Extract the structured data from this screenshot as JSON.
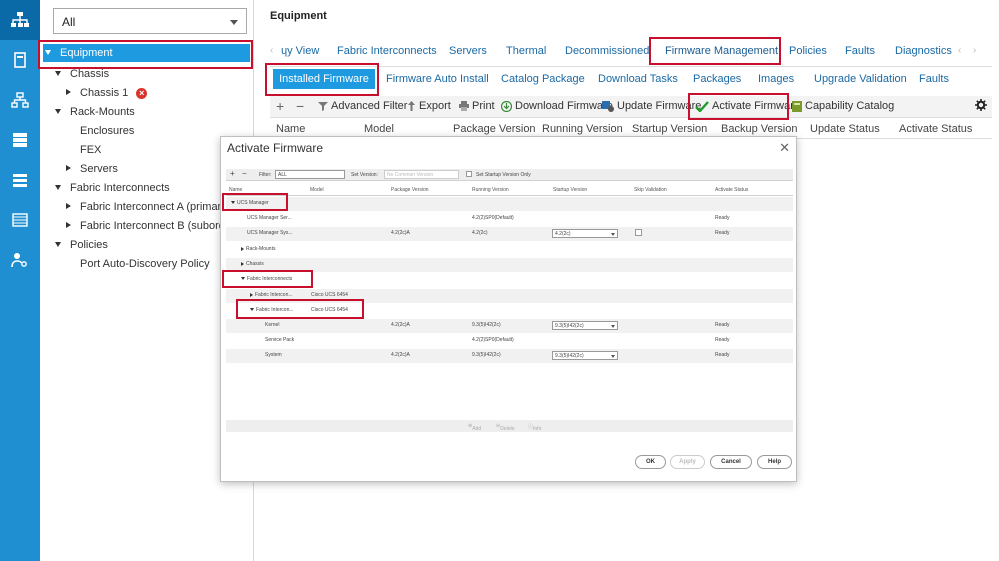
{
  "sidebar": {
    "filter_value": "All",
    "tree": {
      "equipment": "Equipment",
      "chassis": "Chassis",
      "chassis_1": "Chassis 1",
      "rack_mounts": "Rack-Mounts",
      "enclosures": "Enclosures",
      "fex": "FEX",
      "servers": "Servers",
      "fabric_interconnects": "Fabric Interconnects",
      "fi_a": "Fabric Interconnect A (primary)",
      "fi_b": "Fabric Interconnect B (subordinate)",
      "policies": "Policies",
      "port_auto_discovery": "Port Auto-Discovery Policy"
    }
  },
  "main": {
    "title": "Equipment",
    "tabs": [
      "ɥy View",
      "Fabric Interconnects",
      "Servers",
      "Thermal",
      "Decommissioned",
      "Firmware Management",
      "Policies",
      "Faults",
      "Diagnostics"
    ],
    "subtabs": [
      "Installed Firmware",
      "Firmware Auto Install",
      "Catalog Package",
      "Download Tasks",
      "Packages",
      "Images",
      "Upgrade Validation",
      "Faults"
    ],
    "toolbar": {
      "add": "+",
      "remove": "−",
      "advanced_filter": "Advanced Filter",
      "export": "Export",
      "print": "Print",
      "download_firmware": "Download Firmware",
      "update_firmware": "Update Firmware",
      "activate_firmware": "Activate Firmware",
      "capability_catalog": "Capability Catalog"
    },
    "columns": [
      "Name",
      "Model",
      "Package Version",
      "Running Version",
      "Startup Version",
      "Backup Version",
      "Update Status",
      "Activate Status"
    ]
  },
  "dialog": {
    "title": "Activate Firmware",
    "close": "✕",
    "toolbar": {
      "add": "+",
      "remove": "−",
      "filter_label": "Filter:",
      "filter_value": "ALL",
      "set_version_label": "Set Version:",
      "set_version_value": "No Common Version",
      "set_startup_only": "Set Startup Version Only"
    },
    "columns": [
      "Name",
      "Model",
      "Package Version",
      "Running Version",
      "Startup Version",
      "Skip Validation",
      "Activate Status"
    ],
    "rows": [
      {
        "name": "UCS Manager",
        "model": "",
        "pkg": "",
        "running": "",
        "startup": "",
        "status": ""
      },
      {
        "name": "UCS Manager Ser...",
        "model": "",
        "pkg": "",
        "running": "4.2(2)SP0(Default)",
        "startup": "",
        "status": "Ready"
      },
      {
        "name": "UCS Manager Sys...",
        "model": "",
        "pkg": "4.2(2c)A",
        "running": "4.2(2c)",
        "startup": "4.2(2c)",
        "status": "Ready"
      },
      {
        "name": "Rack-Mounts",
        "model": "",
        "pkg": "",
        "running": "",
        "startup": "",
        "status": ""
      },
      {
        "name": "Chassis",
        "model": "",
        "pkg": "",
        "running": "",
        "startup": "",
        "status": ""
      },
      {
        "name": "Fabric Interconnects",
        "model": "",
        "pkg": "",
        "running": "",
        "startup": "",
        "status": ""
      },
      {
        "name": "Fabric Intercon...",
        "model": "Cisco UCS 6454",
        "pkg": "",
        "running": "",
        "startup": "",
        "status": ""
      },
      {
        "name": "Fabric Intercon...",
        "model": "Cisco UCS 6454",
        "pkg": "",
        "running": "",
        "startup": "",
        "status": ""
      },
      {
        "name": "Kernel",
        "model": "",
        "pkg": "4.2(2c)A",
        "running": "9.3(5)I42(2c)",
        "startup": "9.3(5)I42(2c)",
        "status": "Ready"
      },
      {
        "name": "Service Pack",
        "model": "",
        "pkg": "",
        "running": "4.2(2)SP0(Default)",
        "startup": "",
        "status": "Ready"
      },
      {
        "name": "System",
        "model": "",
        "pkg": "4.2(2c)A",
        "running": "9.3(5)I42(2c)",
        "startup": "9.3(5)I42(2c)",
        "status": "Ready"
      }
    ],
    "footer": {
      "add": "Add",
      "delete": "Delete",
      "info": "Info"
    },
    "buttons": {
      "ok": "OK",
      "apply": "Apply",
      "cancel": "Cancel",
      "help": "Help"
    }
  },
  "colors": {
    "brand_blue": "#1e9ae0",
    "rail_blue": "#1f8fd1",
    "highlight_red": "#c8102e",
    "link_blue": "#1a6aa5"
  }
}
